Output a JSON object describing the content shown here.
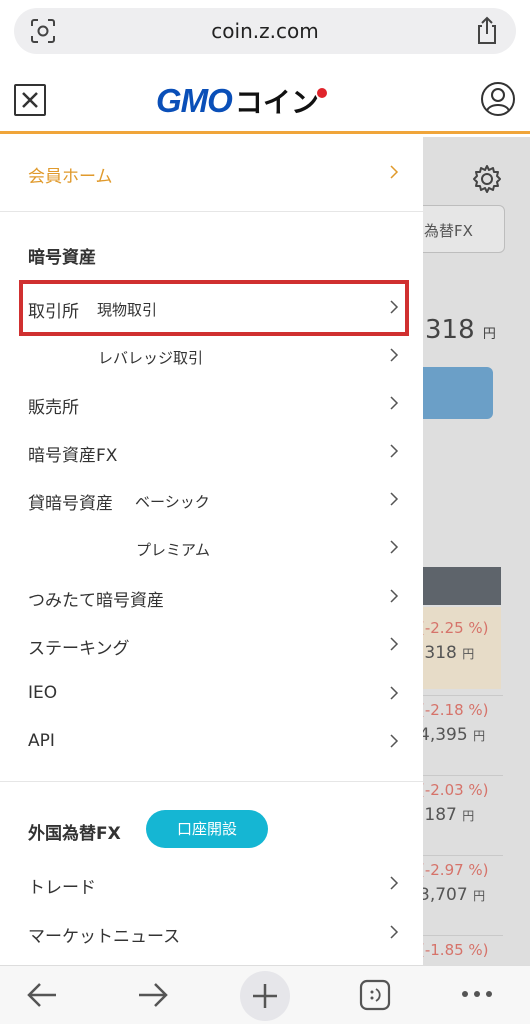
{
  "browser": {
    "url": "coin.z.com"
  },
  "header": {
    "logo_gmo": "GMO",
    "logo_coin": "コイン"
  },
  "background": {
    "tab_label": "為替FX",
    "price": "318",
    "price_unit": "円",
    "rows": [
      {
        "pct": "(-2.25 %)",
        "val": ",318",
        "unit": "円"
      },
      {
        "pct": "(-2.18 %)",
        "val": "4,395",
        "unit": "円"
      },
      {
        "pct": "(-2.03 %)",
        "val": ",187",
        "unit": "円"
      },
      {
        "pct": "(-2.97 %)",
        "val": "3,707",
        "unit": "円"
      },
      {
        "pct": "(-1.85 %)",
        "val": "",
        "unit": ""
      }
    ]
  },
  "menu": {
    "home": "会員ホーム",
    "crypto_section": "暗号資産",
    "exchange": "取引所",
    "exchange_spot": "現物取引",
    "exchange_leverage": "レバレッジ取引",
    "sales": "販売所",
    "crypto_fx": "暗号資産FX",
    "lending": "貸暗号資産",
    "lending_basic": "ベーシック",
    "lending_premium": "プレミアム",
    "tsumitate": "つみたて暗号資産",
    "staking": "ステーキング",
    "ieo": "IEO",
    "api": "API",
    "fx_section": "外国為替FX",
    "open_account": "口座開設",
    "trade": "トレード",
    "market_news": "マーケットニュース"
  },
  "colors": {
    "accent_orange": "#f0a53a",
    "highlight_red": "#d03030",
    "button_cyan": "#15b6d3",
    "logo_blue": "#0a4fb8"
  }
}
